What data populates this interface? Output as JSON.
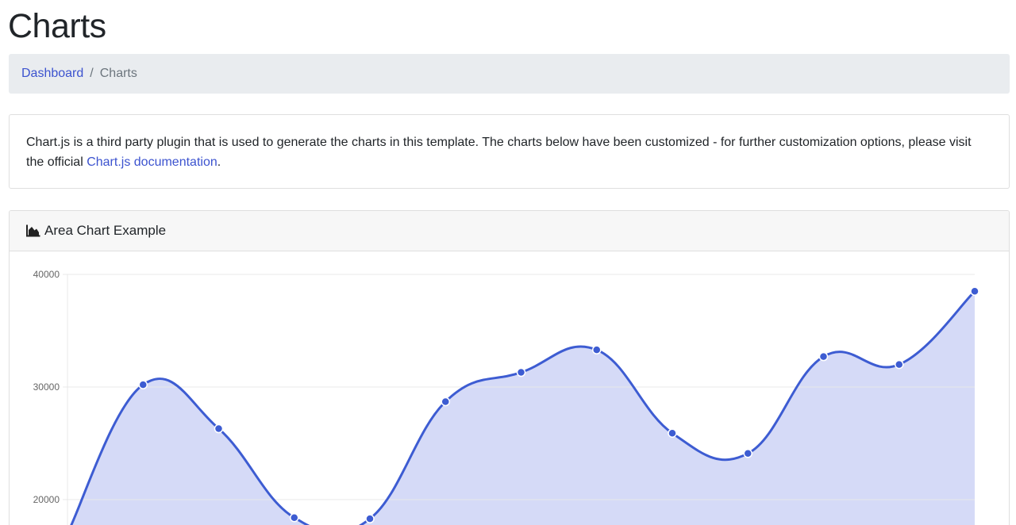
{
  "page": {
    "title": "Charts"
  },
  "breadcrumb": {
    "items": [
      {
        "label": "Dashboard"
      },
      {
        "label": "Charts"
      }
    ],
    "separator": "/"
  },
  "info": {
    "text_before": "Chart.js is a third party plugin that is used to generate the charts in this template. The charts below have been customized - for further customization options, please visit the official ",
    "link_text": "Chart.js documentation",
    "text_after": "."
  },
  "chart_card": {
    "header_icon": "area-chart-icon",
    "header_title": "Area Chart Example"
  },
  "colors": {
    "accent": "#3c53cf",
    "line": "#3d5cd2",
    "fill": "#d5daf7",
    "grid": "#e8e8e8"
  },
  "chart_data": {
    "type": "area",
    "title": "",
    "xlabel": "",
    "ylabel": "",
    "yticks": [
      20000,
      30000,
      40000
    ],
    "ylim": [
      20000,
      40000
    ],
    "grid": true,
    "series": [
      {
        "values": [
          17000,
          30200,
          26300,
          18400,
          18300,
          28700,
          31300,
          33300,
          25900,
          24100,
          32700,
          32000,
          38500
        ]
      }
    ]
  }
}
